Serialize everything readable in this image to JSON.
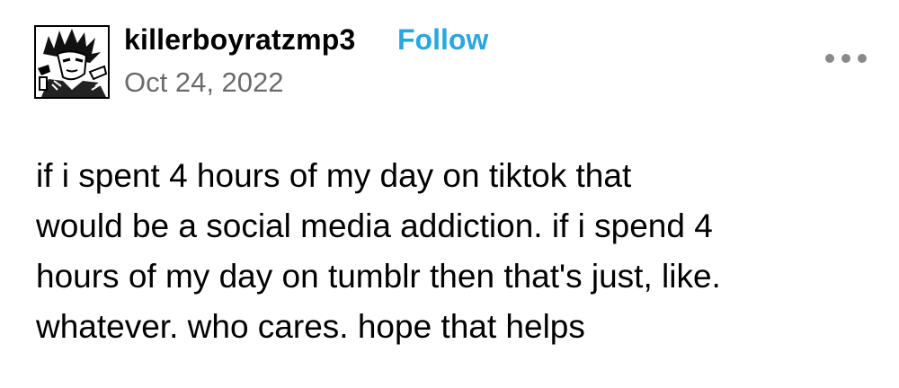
{
  "post": {
    "username": "killerboyratzmp3",
    "follow_label": "Follow",
    "date": "Oct 24, 2022",
    "more_icon": "more-horizontal-icon",
    "avatar_icon": "user-avatar-illustration",
    "body_lines": [
      "if i spent 4 hours of my day on tiktok that",
      "would be a social media addiction. if i spend 4",
      "hours of my day on tumblr then that's just, like.",
      "whatever. who cares. hope that helps"
    ]
  },
  "colors": {
    "follow": "#2ba7e0",
    "date": "#6b6b6b",
    "more_dots": "#8a8a8a",
    "text": "#000000",
    "background": "#ffffff"
  }
}
